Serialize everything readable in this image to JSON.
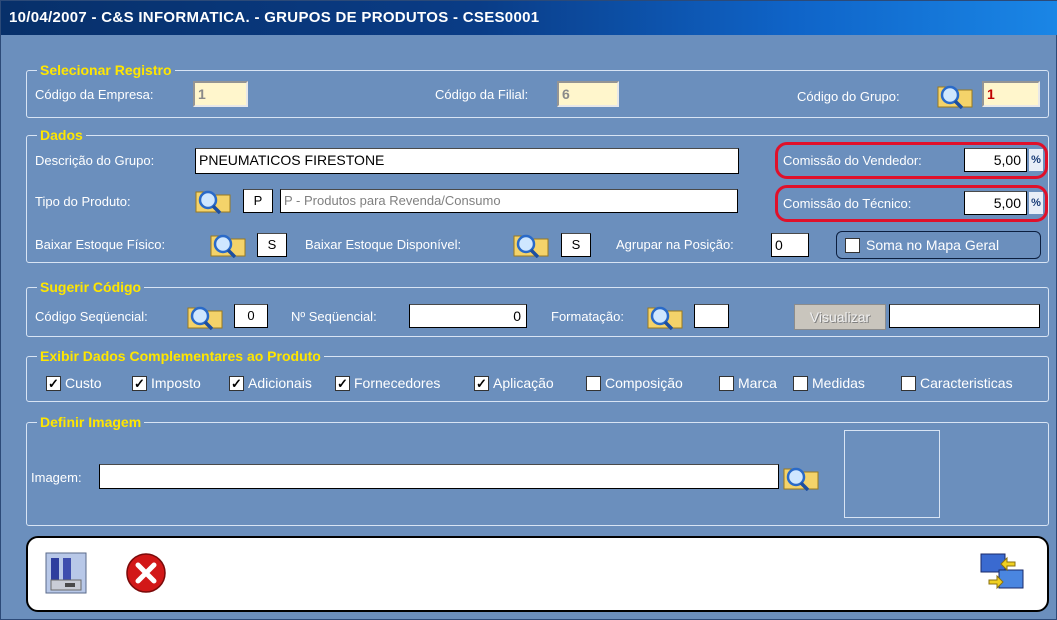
{
  "window": {
    "title": "10/04/2007  -  C&S INFORMATICA.  -  GRUPOS DE PRODUTOS  -  CSES0001"
  },
  "selecionar": {
    "legend": "Selecionar Registro",
    "empresa_label": "Código da Empresa:",
    "empresa_value": "1",
    "filial_label": "Código da Filial:",
    "filial_value": "6",
    "grupo_label": "Código do Grupo:",
    "grupo_value": "1"
  },
  "dados": {
    "legend": "Dados",
    "descricao_label": "Descrição do Grupo:",
    "descricao_value": "PNEUMATICOS FIRESTONE",
    "comissao_vendedor_label": "Comissão do Vendedor:",
    "comissao_vendedor_value": "5,00",
    "comissao_tecnico_label": "Comissão do Técnico:",
    "comissao_tecnico_value": "5,00",
    "percent_symbol": "%",
    "tipo_label": "Tipo do Produto:",
    "tipo_code": "P",
    "tipo_desc": "P - Produtos para Revenda/Consumo",
    "baixar_fisico_label": "Baixar Estoque Físico:",
    "baixar_fisico_value": "S",
    "baixar_disponivel_label": "Baixar Estoque Disponível:",
    "baixar_disponivel_value": "S",
    "agrupar_label": "Agrupar na Posição:",
    "agrupar_value": "0",
    "soma_label": "Soma no Mapa Geral",
    "soma_checked": false
  },
  "sugerir": {
    "legend": "Sugerir Código",
    "seq_label": "Código Seqüencial:",
    "seq_value": "0",
    "nseq_label": "Nº Seqüencial:",
    "nseq_value": "0",
    "formatacao_label": "Formatação:",
    "formatacao_value": "",
    "visualizar_label": "Visualizar",
    "visualizar_output": ""
  },
  "exibir": {
    "legend": "Exibir Dados Complementares ao Produto",
    "items": [
      {
        "label": "Custo",
        "checked": true
      },
      {
        "label": "Imposto",
        "checked": true
      },
      {
        "label": "Adicionais",
        "checked": true
      },
      {
        "label": "Fornecedores",
        "checked": true
      },
      {
        "label": "Aplicação",
        "checked": true
      },
      {
        "label": "Composição",
        "checked": false
      },
      {
        "label": "Marca",
        "checked": false
      },
      {
        "label": "Medidas",
        "checked": false
      },
      {
        "label": "Caracteristicas",
        "checked": false
      }
    ]
  },
  "imagem": {
    "legend": "Definir Imagem",
    "label": "Imagem:",
    "value": ""
  },
  "colors": {
    "panel": "#6b8fbd",
    "legend": "#ffe600",
    "highlight": "#e0102a"
  },
  "icons": {
    "search": "search-folder-icon",
    "save": "save-disk-icon",
    "cancel": "cancel-x-icon",
    "exchange": "exchange-monitors-icon"
  }
}
